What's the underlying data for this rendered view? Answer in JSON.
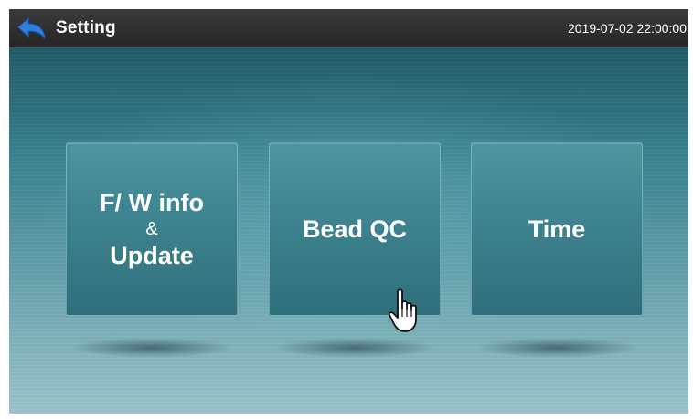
{
  "header": {
    "title": "Setting",
    "datetime": "2019-07-02  22:00:00",
    "back_icon": "back-arrow-icon"
  },
  "tiles": [
    {
      "line1": "F/ W info",
      "amp": "&",
      "line2": "Update"
    },
    {
      "label": "Bead QC"
    },
    {
      "label": "Time"
    }
  ],
  "cursor_icon": "hand-pointer-icon",
  "colors": {
    "titlebar": "#2e2e2e",
    "back_arrow": "#2f7fe0",
    "tile": "#3f8591",
    "background_top": "#1f5a66",
    "background_bottom": "#9cc4cb"
  }
}
